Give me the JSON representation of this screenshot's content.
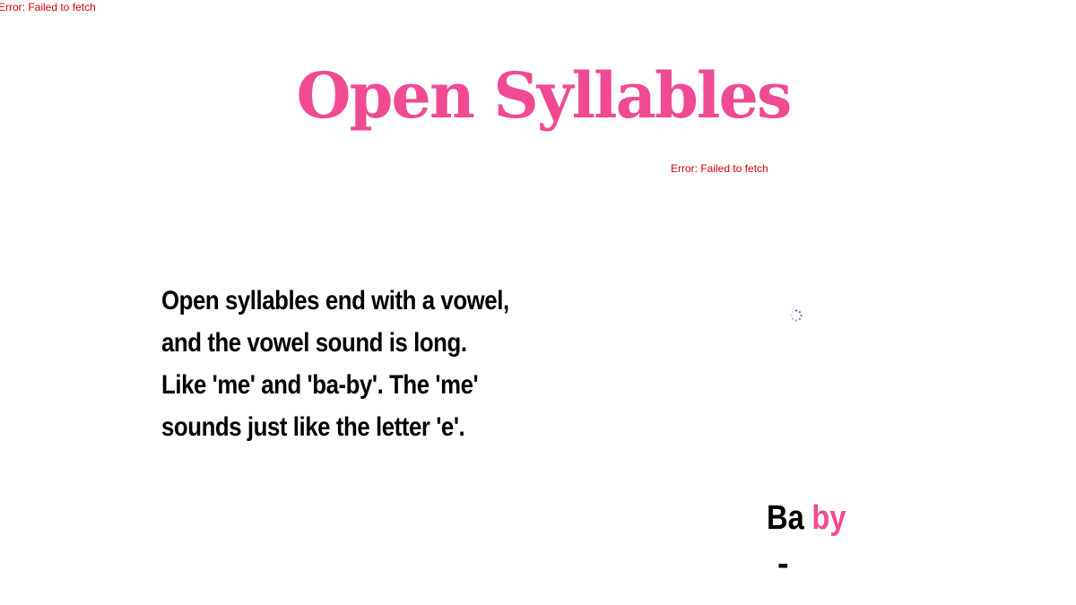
{
  "errors": {
    "top": "Error: Failed to fetch",
    "middle": "Error: Failed to fetch"
  },
  "title": "Open Syllables",
  "body": {
    "lines": [
      "Open syllables end with a vowel,",
      "and the vowel sound is long.",
      "Like 'me' and 'ba-by'. The 'me'",
      "sounds just like the letter 'e'."
    ]
  },
  "example": {
    "syllable_1": "Ba",
    "syllable_2": "by",
    "hyphen": "-"
  },
  "icons": {
    "loading": "loading-spinner-icon"
  },
  "colors": {
    "accent": "#f04a94",
    "error": "#d40000",
    "text": "#000000",
    "spinner": "#3a4fc4"
  }
}
